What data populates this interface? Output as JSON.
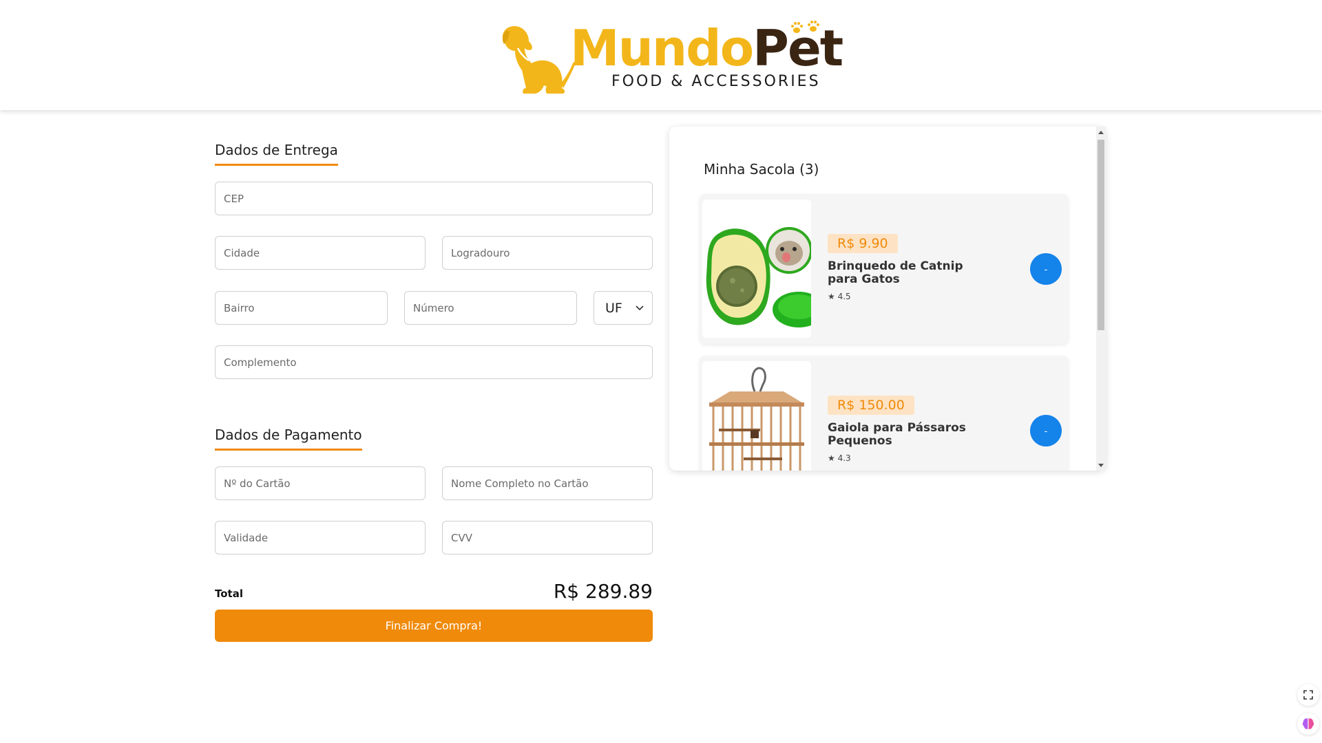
{
  "header": {
    "logo_word_1": "Mundo",
    "logo_word_2": "Pet",
    "logo_tagline": "FOOD & ACCESSORIES"
  },
  "delivery": {
    "title": "Dados de Entrega",
    "cep_placeholder": "CEP",
    "cidade_placeholder": "Cidade",
    "logradouro_placeholder": "Logradouro",
    "bairro_placeholder": "Bairro",
    "numero_placeholder": "Número",
    "uf_selected": "UF",
    "complemento_placeholder": "Complemento"
  },
  "payment": {
    "title": "Dados de Pagamento",
    "card_number_placeholder": "Nº do Cartão",
    "card_name_placeholder": "Nome Completo no Cartão",
    "validity_placeholder": "Validade",
    "cvv_placeholder": "CVV"
  },
  "summary": {
    "total_label": "Total",
    "total_value": "R$ 289.89",
    "finish_label": "Finalizar Compra!"
  },
  "cart": {
    "title": "Minha Sacola (3)",
    "items": [
      {
        "price": "R$ 9.90",
        "name": "Brinquedo de Catnip para Gatos",
        "rating": "★ 4.5",
        "remove_label": "-"
      },
      {
        "price": "R$ 150.00",
        "name": "Gaiola para Pássaros Pequenos",
        "rating": "★ 4.3",
        "remove_label": "-"
      }
    ]
  },
  "colors": {
    "accent": "#f08a0a",
    "brand_yellow": "#f3b61a",
    "brand_brown": "#3a2513",
    "remove_blue": "#1483ea",
    "badge_bg": "#fde3c4"
  },
  "icons": {
    "uf_select": "chevron-down-icon",
    "side_button_1": "expand-icon",
    "side_button_2": "brain-icon"
  }
}
